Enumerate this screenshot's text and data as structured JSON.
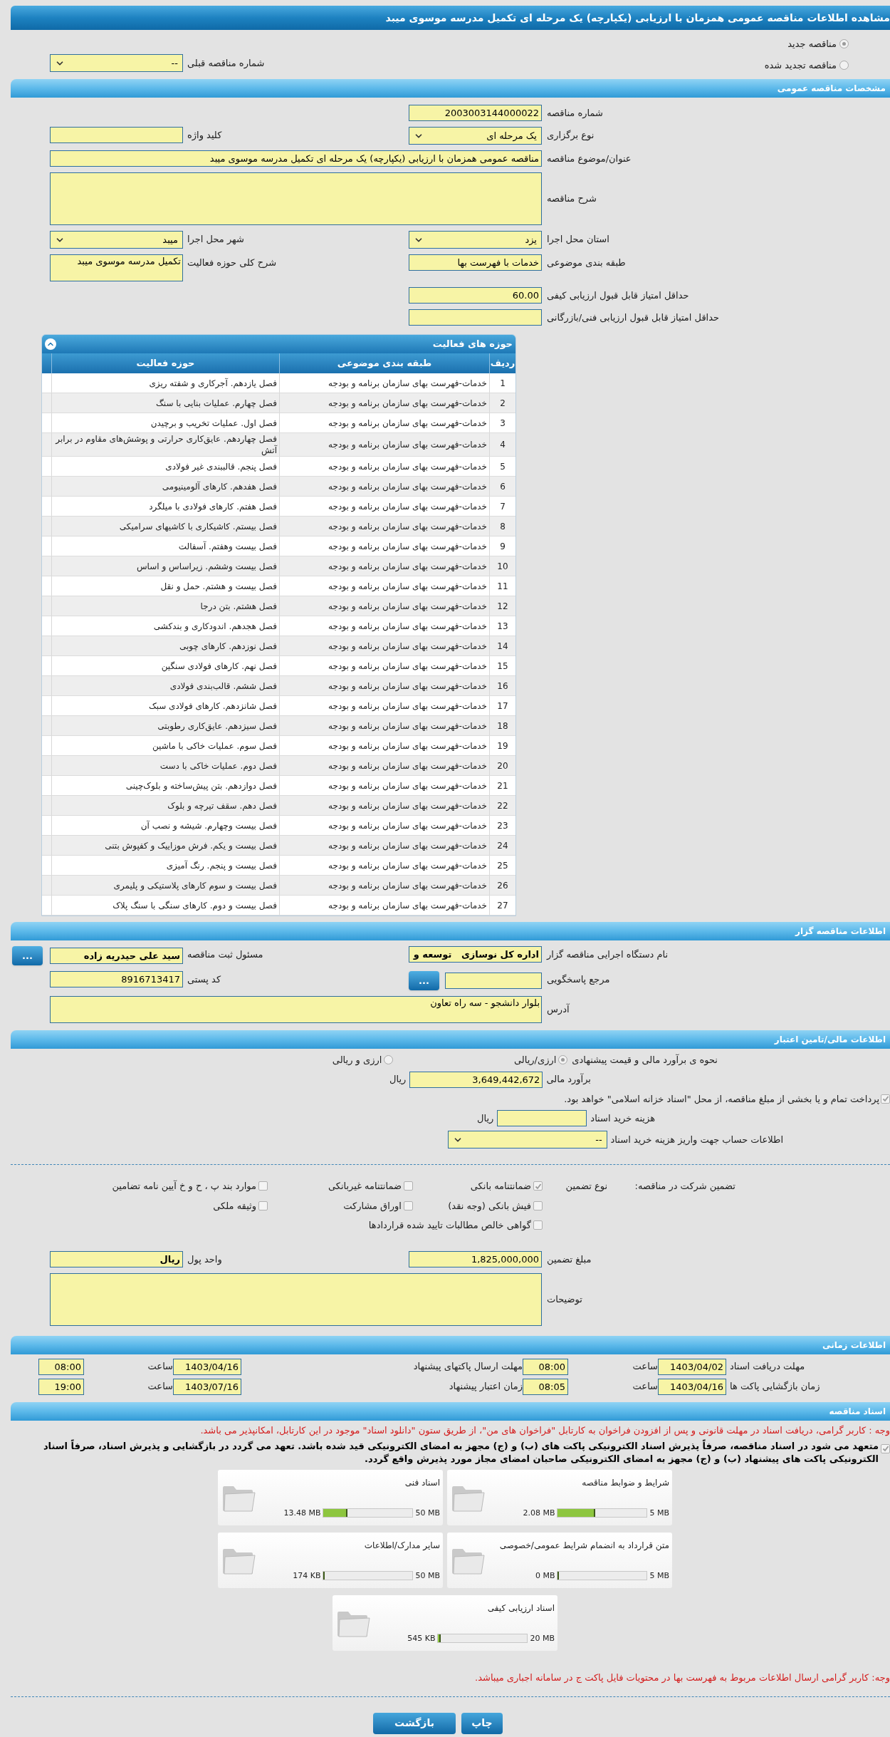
{
  "title": "مشاهده اطلاعات مناقصه عمومی همزمان با ارزیابی (یکپارچه) یک مرحله ای تکمیل مدرسه موسوی میبد",
  "tender_type": [
    {
      "label": "مناقصه جدید",
      "selected": true
    },
    {
      "label": "مناقصه تجدید شده",
      "selected": false
    }
  ],
  "previous_tender": {
    "label": "شماره مناقصه قبلی",
    "value": "--"
  },
  "general": {
    "header": "مشخصات مناقصه عمومی",
    "rows": [
      {
        "right": {
          "label": "شماره مناقصه",
          "kind": "text",
          "value": "2003003144000022"
        }
      },
      {
        "right": {
          "label": "نوع برگزاری",
          "kind": "select",
          "value": "یک مرحله ای"
        },
        "left": {
          "label": "کلید واژه",
          "kind": "text"
        }
      },
      {
        "full": {
          "label": "عنوان/موضوع مناقصه",
          "kind": "text",
          "value": "مناقصه عمومی همزمان با ارزیابی (یکپارچه) یک مرحله ای تکمیل مدرسه موسوی میبد"
        }
      },
      {
        "full": {
          "label": "شرح مناقصه",
          "kind": "textarea"
        }
      },
      {
        "right": {
          "label": "استان محل اجرا",
          "kind": "select",
          "value": "یزد"
        },
        "left": {
          "label": "شهر محل اجرا",
          "kind": "select",
          "value": "میبد"
        }
      },
      {
        "right": {
          "label": "طبقه بندی موضوعی",
          "kind": "text",
          "value": "خدمات با فهرست بها"
        },
        "left": {
          "label": "شرح کلی حوزه فعالیت",
          "kind": "textarea",
          "value": "تکمیل مدرسه موسوی میبد"
        }
      },
      {
        "right": {
          "label": "حداقل امتیاز قابل قبول ارزیابی کیفی",
          "kind": "text",
          "value": "60.00"
        }
      },
      {
        "right": {
          "label": "حداقل امتیاز قابل قبول ارزیابی فنی/بازرگانی",
          "kind": "text"
        }
      }
    ]
  },
  "activities": {
    "header": "حوزه های فعالیت",
    "columns": [
      "ردیف",
      "طبقه بندی موضوعی",
      "حوزه فعالیت"
    ],
    "rows": [
      {
        "n": "1",
        "category": "خدمات-فهرست بهای سازمان برنامه و بودجه",
        "activity": "فصل یازدهم. آجرکاری و شفته ریزی"
      },
      {
        "n": "2",
        "category": "خدمات-فهرست بهای سازمان برنامه و بودجه",
        "activity": "فصل چهارم. عملیات بنایی با سنگ"
      },
      {
        "n": "3",
        "category": "خدمات-فهرست بهای سازمان برنامه و بودجه",
        "activity": "فصل اول. عملیات تخریب و برچیدن"
      },
      {
        "n": "4",
        "category": "خدمات-فهرست بهای سازمان برنامه و بودجه",
        "activity": "فصل چهاردهم. عایق‌کاری حرارتی و پوشش‌های مقاوم در برابر آتش"
      },
      {
        "n": "5",
        "category": "خدمات-فهرست بهای سازمان برنامه و بودجه",
        "activity": "فصل پنجم. قالببندی غیر فولادی"
      },
      {
        "n": "6",
        "category": "خدمات-فهرست بهای سازمان برنامه و بودجه",
        "activity": "فصل هفدهم. کارهای آلومینیومی"
      },
      {
        "n": "7",
        "category": "خدمات-فهرست بهای سازمان برنامه و بودجه",
        "activity": "فصل هفتم. کارهای فولادی با میلگرد"
      },
      {
        "n": "8",
        "category": "خدمات-فهرست بهای سازمان برنامه و بودجه",
        "activity": "فصل بیستم. کاشیکاری با کاشیهای سرامیکی"
      },
      {
        "n": "9",
        "category": "خدمات-فهرست بهای سازمان برنامه و بودجه",
        "activity": "فصل بیست وهفتم. آسفالت"
      },
      {
        "n": "10",
        "category": "خدمات-فهرست بهای سازمان برنامه و بودجه",
        "activity": "فصل بیست وششم. زیراساس و اساس"
      },
      {
        "n": "11",
        "category": "خدمات-فهرست بهای سازمان برنامه و بودجه",
        "activity": "فصل بیست و هشتم. حمل و نقل"
      },
      {
        "n": "12",
        "category": "خدمات-فهرست بهای سازمان برنامه و بودجه",
        "activity": "فصل هشتم. بتن درجا"
      },
      {
        "n": "13",
        "category": "خدمات-فهرست بهای سازمان برنامه و بودجه",
        "activity": "فصل هجدهم. اندودکاری و بندکشی"
      },
      {
        "n": "14",
        "category": "خدمات-فهرست بهای سازمان برنامه و بودجه",
        "activity": "فصل نوزدهم. کارهای چوبی"
      },
      {
        "n": "15",
        "category": "خدمات-فهرست بهای سازمان برنامه و بودجه",
        "activity": "فصل نهم. کارهای فولادی سنگین"
      },
      {
        "n": "16",
        "category": "خدمات-فهرست بهای سازمان برنامه و بودجه",
        "activity": "فصل ششم. قالب‌بندی فولادی"
      },
      {
        "n": "17",
        "category": "خدمات-فهرست بهای سازمان برنامه و بودجه",
        "activity": "فصل شانزدهم. کارهای فولادی سبک"
      },
      {
        "n": "18",
        "category": "خدمات-فهرست بهای سازمان برنامه و بودجه",
        "activity": "فصل سیزدهم. عایق‌کاری رطوبتی"
      },
      {
        "n": "19",
        "category": "خدمات-فهرست بهای سازمان برنامه و بودجه",
        "activity": "فصل سوم. عملیات خاکی با ماشین"
      },
      {
        "n": "20",
        "category": "خدمات-فهرست بهای سازمان برنامه و بودجه",
        "activity": "فصل دوم. عملیات خاکی با دست"
      },
      {
        "n": "21",
        "category": "خدمات-فهرست بهای سازمان برنامه و بودجه",
        "activity": "فصل دوازدهم. بتن پیش‌ساخته و بلوک‌چینی"
      },
      {
        "n": "22",
        "category": "خدمات-فهرست بهای سازمان برنامه و بودجه",
        "activity": "فصل دهم. سقف تیرچه و بلوک"
      },
      {
        "n": "23",
        "category": "خدمات-فهرست بهای سازمان برنامه و بودجه",
        "activity": "فصل بیست وچهارم. شیشه و نصب آن"
      },
      {
        "n": "24",
        "category": "خدمات-فهرست بهای سازمان برنامه و بودجه",
        "activity": "فصل بیست و یکم. فرش موزاییک و کفپوش بتنی"
      },
      {
        "n": "25",
        "category": "خدمات-فهرست بهای سازمان برنامه و بودجه",
        "activity": "فصل بیست و پنجم. رنگ آمیزی"
      },
      {
        "n": "26",
        "category": "خدمات-فهرست بهای سازمان برنامه و بودجه",
        "activity": "فصل بیست و سوم کارهای پلاستیکی و پلیمری"
      },
      {
        "n": "27",
        "category": "خدمات-فهرست بهای سازمان برنامه و بودجه",
        "activity": "فصل بیست و دوم. کارهای سنگی با سنگ پلاک"
      }
    ]
  },
  "organizer": {
    "header": "اطلاعات مناقصه گزار",
    "rows": [
      {
        "right": {
          "label": "نام دستگاه اجرایی مناقصه گزار",
          "kind": "text",
          "value": "اداره کل نوسازی   توسعه و",
          "bold": true
        },
        "left": {
          "label": "مسئول ثبت مناقصه",
          "kind": "text",
          "value": "سید علی حیدریه زاده",
          "bold": true,
          "button": "..."
        }
      },
      {
        "right": {
          "label": "مرجع پاسخگویی",
          "kind": "text",
          "button": "..."
        },
        "left": {
          "label": "کد پستی",
          "kind": "text",
          "value": "8916713417"
        }
      },
      {
        "full": {
          "label": "آدرس",
          "kind": "textarea",
          "value": "بلوار دانشجو - سه راه تعاون"
        }
      }
    ]
  },
  "finance": {
    "header": "اطلاعات مالی/تامین اعتبار",
    "estimate_method": {
      "label": "نحوه ی برآورد مالی و قیمت پیشنهادی",
      "options": [
        {
          "label": "ارزی/ریالی",
          "selected": true
        },
        {
          "label": "ارزی و ریالی",
          "selected": false
        }
      ]
    },
    "estimate": {
      "label": "برآورد مالی",
      "value": "3,649,442,672",
      "unit": "ریال"
    },
    "treasury": {
      "checked": true,
      "text": "پرداخت تمام و یا بخشی از مبلغ مناقصه، از محل \"اسناد خزانه اسلامی\" خواهد بود."
    },
    "document_fee": {
      "label": "هزینه خرید اسناد",
      "unit": "ریال"
    },
    "fee_account": {
      "label": "اطلاعات حساب جهت واریز هزینه خرید اسناد",
      "value": "--"
    },
    "guarantee": {
      "title": "تضمین شرکت در مناقصه:",
      "type_label": "نوع تضمین",
      "rows": [
        [
          {
            "label": "ضمانتنامه بانکی",
            "checked": true
          },
          {
            "label": "ضمانتنامه غیربانکی",
            "checked": false
          },
          {
            "label": "موارد بند پ ، ح و خ آیین نامه تضامین",
            "checked": false
          }
        ],
        [
          {
            "label": "فیش بانکی (وجه نقد)",
            "checked": false
          },
          {
            "label": "اوراق مشارکت",
            "checked": false
          },
          {
            "label": "وثیقه ملکی",
            "checked": false
          }
        ],
        [
          {
            "label": "گواهی خالص مطالبات تایید شده قراردادها",
            "checked": false
          }
        ]
      ]
    },
    "guarantee_amount": {
      "label": "مبلغ تضمین",
      "value": "1,825,000,000"
    },
    "currency": {
      "label": "واحد پول",
      "value": "ریال"
    },
    "notes": {
      "label": "توضیحات"
    }
  },
  "schedule": {
    "header": "اطلاعات زمانی",
    "rows": [
      [
        {
          "label": "مهلت دریافت اسناد",
          "date": "1403/04/02",
          "time_label": "ساعت",
          "time": "08:00"
        },
        {
          "label": "مهلت ارسال پاکتهای پیشنهاد",
          "date": "1403/04/16",
          "time_label": "ساعت",
          "time": "08:00"
        }
      ],
      [
        {
          "label": "زمان بازگشایی پاکت ها",
          "date": "1403/04/16",
          "time_label": "ساعت",
          "time": "08:05"
        },
        {
          "label": "زمان اعتبار پیشنهاد",
          "date": "1403/07/16",
          "time_label": "ساعت",
          "time": "19:00"
        }
      ]
    ]
  },
  "documents": {
    "header": "اسناد مناقصه",
    "note": "وجه : کاربر گرامی، دریافت اسناد در مهلت قانونی و پس از افزودن فراخوان به کارتابل \"فراخوان های من\"، از طریق ستون \"دانلود اسناد\" موجود در این کارتابل، امکانپذیر می باشد.",
    "commitment": {
      "checked": true,
      "text": "متعهد می شود در اسناد مناقصه، صرفاً پذیرش اسناد الکترونیکی پاکت های (ب) و (ج) مجهز به امضای الکترونیکی قید شده باشد. تعهد می گردد در بازگشایی و پذیرش اسناد، صرفاً اسناد الکترونیکی پاکت های پیشنهاد (ب) و (ج) مجهز به امضای الکترونیکی صاحبان امضای مجاز مورد پذیرش واقع گردد."
    },
    "files": [
      {
        "title": "شرایط و ضوابط مناقصه",
        "used": "2.08 MB",
        "max": "5 MB",
        "level": 0.42
      },
      {
        "title": "اسناد فنی",
        "used": "13.48 MB",
        "max": "50 MB",
        "level": 0.27
      },
      {
        "title": "متن قرارداد به انضمام شرایط عمومی/خصوصی",
        "used": "0 MB",
        "max": "5 MB",
        "level": 0
      },
      {
        "title": "سایر مدارک/اطلاعات",
        "used": "174 KB",
        "max": "50 MB",
        "level": 0.004
      },
      {
        "title": "اسناد ارزیابی کیفی",
        "used": "545 KB",
        "max": "20 MB",
        "level": 0.03
      }
    ],
    "footer_note": "وجه: کاربر گرامی ارسال اطلاعات مربوط به فهرست بها در محتویات فایل پاکت ج در سامانه اجباری میباشد."
  },
  "buttons": [
    "چاپ",
    "بازگشت"
  ]
}
